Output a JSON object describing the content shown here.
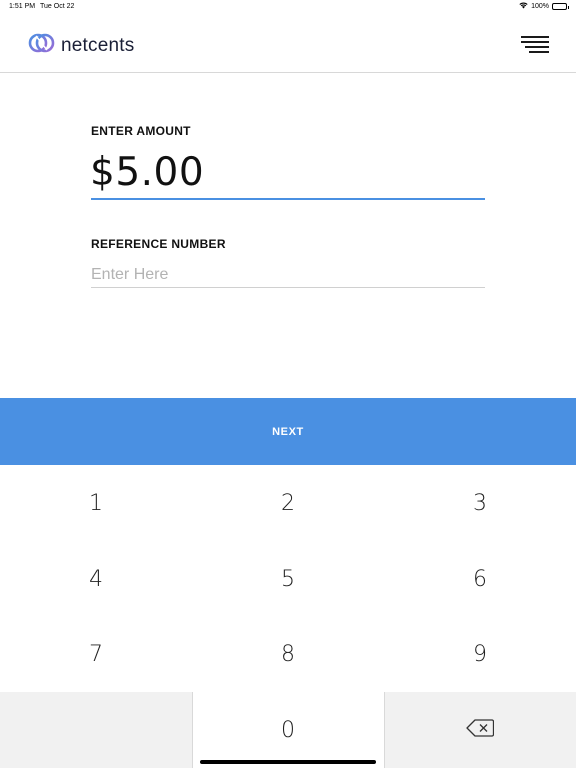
{
  "status_bar": {
    "time": "1:51 PM",
    "date": "Tue Oct 22",
    "battery": "100%"
  },
  "header": {
    "brand": "netcents",
    "brand_colors": {
      "primary": "#4a90e2",
      "secondary": "#8f6ad9"
    },
    "menu_icon": "hamburger-menu-icon"
  },
  "form": {
    "amount_label": "ENTER AMOUNT",
    "amount_value": "$5.00",
    "reference_label": "REFERENCE NUMBER",
    "reference_placeholder": "Enter Here",
    "reference_value": ""
  },
  "next_button_label": "NEXT",
  "keypad": {
    "digits": [
      "1",
      "2",
      "3",
      "4",
      "5",
      "6",
      "7",
      "8",
      "9",
      "0"
    ],
    "backspace_icon": "backspace-icon"
  },
  "colors": {
    "accent": "#4a90e2",
    "keypad_gray": "#f1f1f1"
  }
}
